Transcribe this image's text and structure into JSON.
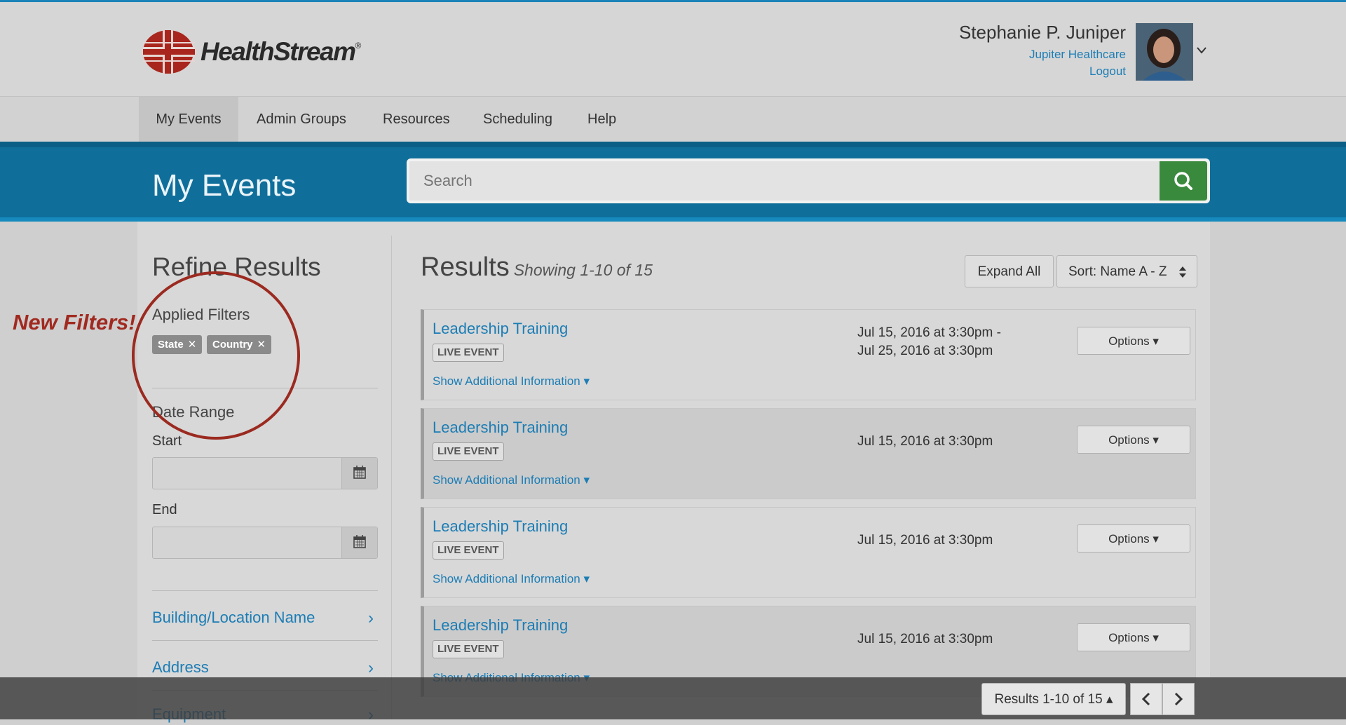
{
  "brand": {
    "name": "HealthStream",
    "registered": "®",
    "logo_color": "#a8261d"
  },
  "user": {
    "name": "Stephanie P. Juniper",
    "organization": "Jupiter Healthcare",
    "logout": "Logout"
  },
  "nav": {
    "items": [
      {
        "label": "My Events",
        "active": true
      },
      {
        "label": "Admin Groups"
      },
      {
        "label": "Resources"
      },
      {
        "label": "Scheduling"
      },
      {
        "label": "Help"
      }
    ]
  },
  "page": {
    "title": "My Events"
  },
  "search": {
    "placeholder": "Search",
    "value": ""
  },
  "sidebar": {
    "title": "Refine Results",
    "applied_filters_label": "Applied Filters",
    "chips": [
      {
        "label": "State"
      },
      {
        "label": "Country"
      }
    ],
    "date_range_label": "Date Range",
    "start_label": "Start",
    "end_label": "End",
    "facets": [
      {
        "label": "Building/Location Name"
      },
      {
        "label": "Address"
      },
      {
        "label": "Equipment"
      }
    ]
  },
  "results": {
    "title": "Results",
    "showing": "Showing 1-10 of 15",
    "expand_all": "Expand All",
    "sort": "Sort: Name A - Z",
    "events": [
      {
        "name": "Leadership Training",
        "type": "LIVE EVENT",
        "more": "Show Additional Information",
        "date_line1": "Jul 15, 2016 at 3:30pm -",
        "date_line2": "Jul 25, 2016 at 3:30pm",
        "options": "Options"
      },
      {
        "name": "Leadership Training",
        "type": "LIVE EVENT",
        "more": "Show Additional Information",
        "date_line1": "Jul 15, 2016 at 3:30pm",
        "date_line2": "",
        "options": "Options"
      },
      {
        "name": "Leadership Training",
        "type": "LIVE EVENT",
        "more": "Show Additional Information",
        "date_line1": "Jul 15, 2016 at 3:30pm",
        "date_line2": "",
        "options": "Options"
      },
      {
        "name": "Leadership Training",
        "type": "LIVE EVENT",
        "more": "Show Additional Information",
        "date_line1": "Jul 15, 2016 at 3:30pm",
        "date_line2": "",
        "options": "Options"
      }
    ]
  },
  "pager": {
    "label": "Results 1-10 of 15"
  },
  "annotation": {
    "callout": "New Filters!",
    "color": "#a12a20"
  },
  "colors": {
    "accent": "#1c7db5",
    "band": "#0f6f9a",
    "search_button": "#3a8a3e"
  }
}
